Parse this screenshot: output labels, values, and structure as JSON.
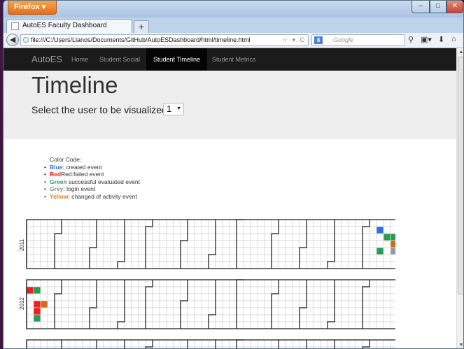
{
  "browser": {
    "menu_button": "Firefox",
    "tab_title": "AutoES Faculty Dashboard",
    "new_tab": "+",
    "url": "file:///C:/Users/Llanos/Documents/GitHub/AutoESDashboard/html/timeline.html",
    "search_placeholder": "Google",
    "search_engine_badge": "8"
  },
  "nav": {
    "brand": "AutoES",
    "links": [
      "Home",
      "Student Social",
      "Student Timeline",
      "Student Metrics"
    ],
    "active": "Student Timeline"
  },
  "hero": {
    "title": "Timeline",
    "selector_label": "Select the user to be visualized:",
    "selected_user": "1"
  },
  "legend": {
    "title": "Color Code:",
    "items": [
      {
        "key": "Blue",
        "suffix": ": created event",
        "color": "#3a6fd8"
      },
      {
        "key": "Red",
        "suffix": "Red:failed event",
        "color": "#e02020"
      },
      {
        "key": "Green",
        "suffix": " successful evaluated event",
        "color": "#2aa060"
      },
      {
        "key": "Grey",
        "suffix": ": login event",
        "color": "#8a8a8a"
      },
      {
        "key": "Yellow",
        "suffix": ": changed of activity event",
        "color": "#e07a1a"
      }
    ]
  },
  "timeline": {
    "years": [
      "2011",
      "2012"
    ],
    "event_colors": {
      "created": "#2f6fd6",
      "failed": "#e8231e",
      "success": "#2b9a55",
      "login": "#8e9aa4",
      "activity": "#d26a1b"
    },
    "events": {
      "2011": [
        {
          "week": 50,
          "day": 1,
          "type": "created"
        },
        {
          "week": 51,
          "day": 2,
          "type": "success"
        },
        {
          "week": 52,
          "day": 2,
          "type": "success"
        },
        {
          "week": 52,
          "day": 3,
          "type": "activity"
        },
        {
          "week": 52,
          "day": 4,
          "type": "login"
        },
        {
          "week": 50,
          "day": 4,
          "type": "success"
        }
      ],
      "2012": [
        {
          "week": 0,
          "day": 1,
          "type": "failed"
        },
        {
          "week": 1,
          "day": 1,
          "type": "success"
        },
        {
          "week": 1,
          "day": 3,
          "type": "failed"
        },
        {
          "week": 2,
          "day": 3,
          "type": "activity"
        },
        {
          "week": 1,
          "day": 4,
          "type": "failed"
        },
        {
          "week": 1,
          "day": 5,
          "type": "success"
        }
      ]
    }
  }
}
